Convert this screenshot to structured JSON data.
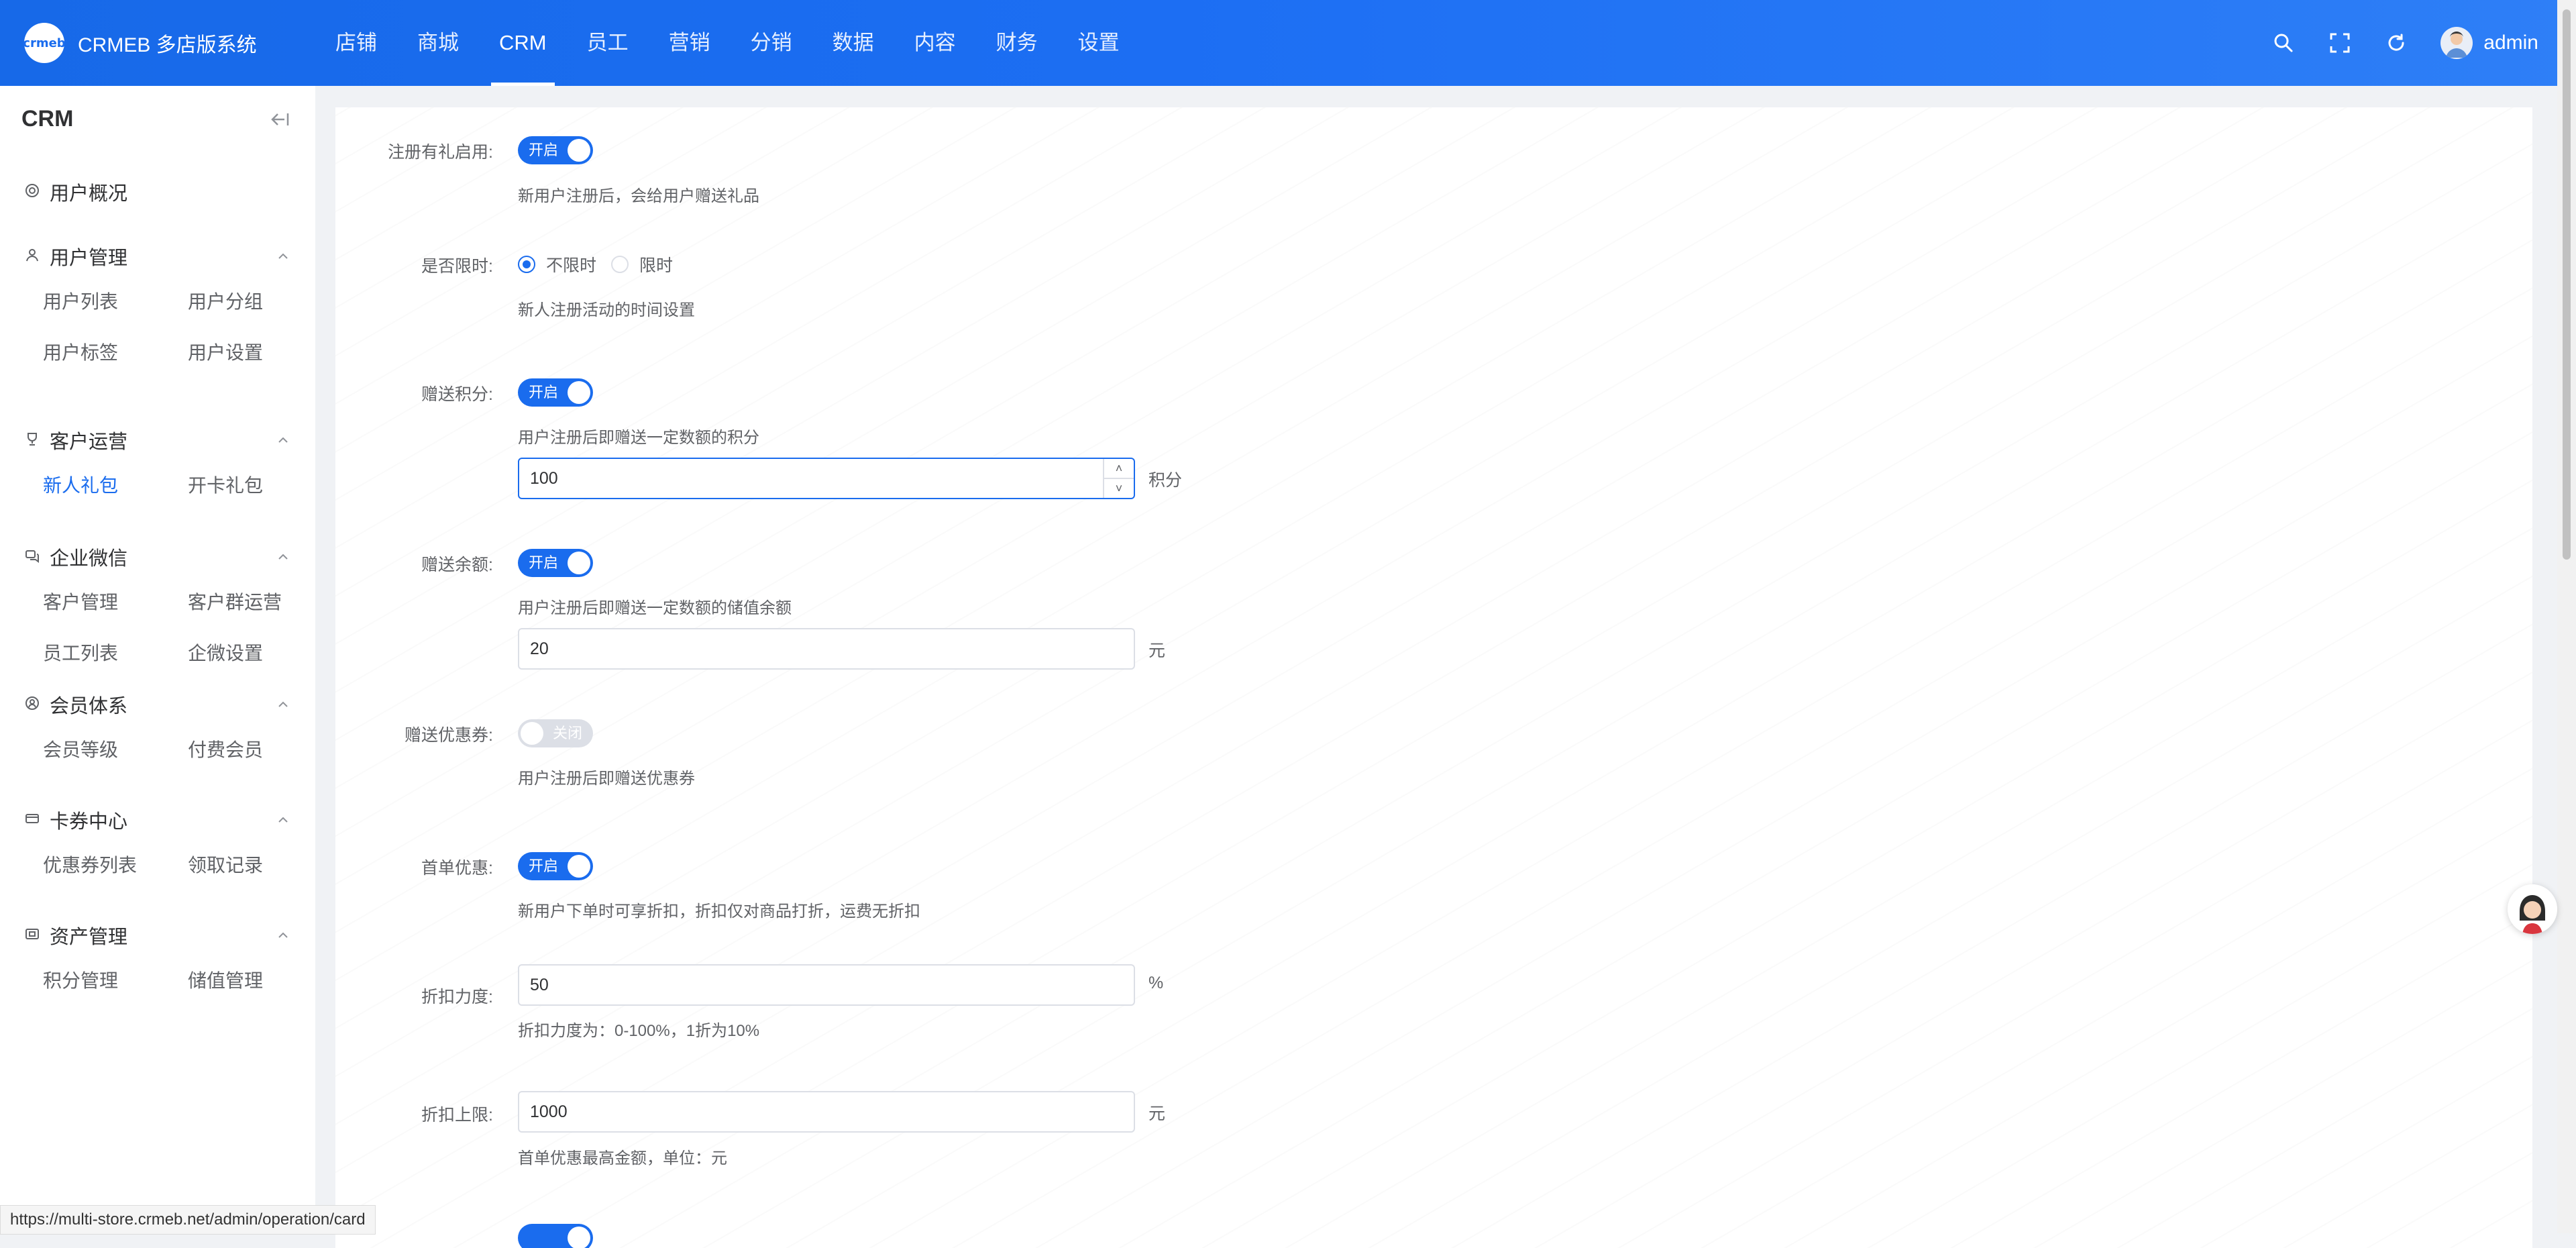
{
  "app": {
    "title": "CRMEB 多店版系统",
    "logo_text": "crmeb"
  },
  "nav": {
    "items": [
      {
        "label": "店铺"
      },
      {
        "label": "商城"
      },
      {
        "label": "CRM",
        "active": true
      },
      {
        "label": "员工"
      },
      {
        "label": "营销"
      },
      {
        "label": "分销"
      },
      {
        "label": "数据"
      },
      {
        "label": "内容"
      },
      {
        "label": "财务"
      },
      {
        "label": "设置"
      }
    ]
  },
  "header_right": {
    "username": "admin",
    "icons": [
      "search-icon",
      "fullscreen-icon",
      "refresh-icon"
    ]
  },
  "sidebar": {
    "title": "CRM",
    "overview": {
      "label": "用户概况",
      "icon": "overview-icon"
    },
    "groups": [
      {
        "label": "用户管理",
        "icon": "user-icon",
        "items": [
          "用户列表",
          "用户分组",
          "用户标签",
          "用户设置"
        ]
      },
      {
        "label": "客户运营",
        "icon": "trophy-icon",
        "items": [
          "新人礼包",
          "开卡礼包"
        ],
        "active_item": "新人礼包"
      },
      {
        "label": "企业微信",
        "icon": "chat-icon",
        "items": [
          "客户管理",
          "客户群运营",
          "员工列表",
          "企微设置"
        ]
      },
      {
        "label": "会员体系",
        "icon": "member-icon",
        "items": [
          "会员等级",
          "付费会员"
        ]
      },
      {
        "label": "卡券中心",
        "icon": "card-icon",
        "items": [
          "优惠券列表",
          "领取记录"
        ]
      },
      {
        "label": "资产管理",
        "icon": "wallet-icon",
        "items": [
          "积分管理",
          "储值管理"
        ]
      }
    ]
  },
  "form": {
    "register_gift": {
      "label": "注册有礼启用:",
      "switch": "开启",
      "on": true,
      "hint": "新用户注册后，会给用户赠送礼品"
    },
    "time_limit": {
      "label": "是否限时:",
      "options": [
        "不限时",
        "限时"
      ],
      "selected": "不限时",
      "hint": "新人注册活动的时间设置"
    },
    "gift_points": {
      "label": "赠送积分:",
      "switch": "开启",
      "on": true,
      "hint": "用户注册后即赠送一定数额的积分",
      "value": "100",
      "unit": "积分"
    },
    "gift_balance": {
      "label": "赠送余额:",
      "switch": "开启",
      "on": true,
      "hint": "用户注册后即赠送一定数额的储值余额",
      "value": "20",
      "unit": "元"
    },
    "gift_coupon": {
      "label": "赠送优惠券:",
      "switch": "关闭",
      "on": false,
      "hint": "用户注册后即赠送优惠券"
    },
    "first_order": {
      "label": "首单优惠:",
      "switch": "开启",
      "on": true,
      "hint": "新用户下单时可享折扣，折扣仅对商品打折，运费无折扣"
    },
    "discount_rate": {
      "label": "折扣力度:",
      "value": "50",
      "unit": "%",
      "hint": "折扣力度为：0-100%，1折为10%"
    },
    "discount_cap": {
      "label": "折扣上限:",
      "value": "1000",
      "unit": "元",
      "hint": "首单优惠最高金额，单位：元"
    }
  },
  "status_bar": {
    "url": "https://multi-store.crmeb.net/admin/operation/card"
  },
  "colors": {
    "primary": "#1a6cee",
    "header_start": "#1769e8",
    "header_end": "#2e7ff7",
    "switch_off": "#dcdfe6"
  }
}
